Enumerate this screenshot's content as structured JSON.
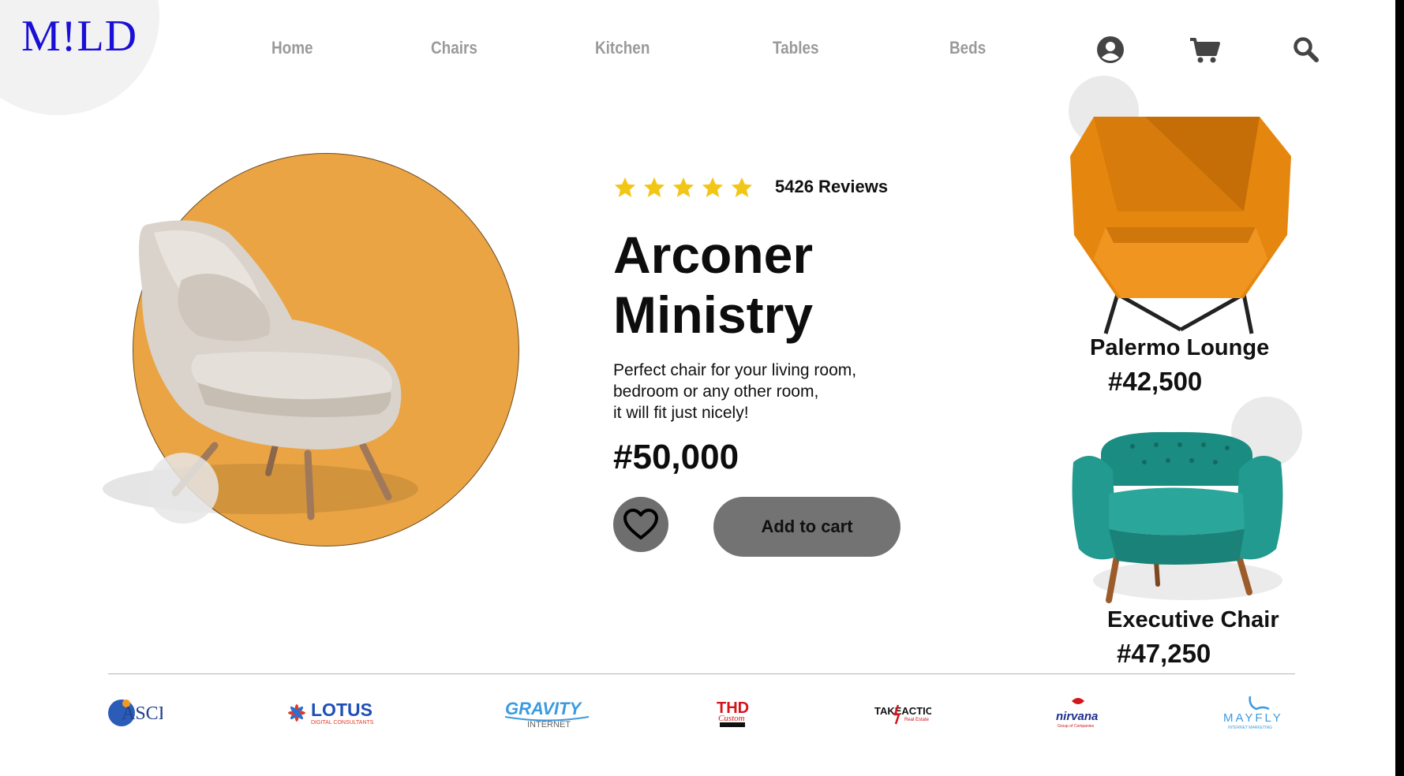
{
  "logo": "M!LD",
  "nav": {
    "items": [
      "Home",
      "Chairs",
      "Kitchen",
      "Tables",
      "Beds"
    ],
    "icons": [
      "user-icon",
      "cart-icon",
      "search-icon"
    ]
  },
  "hero": {
    "rating": 5,
    "reviews": "5426 Reviews",
    "title_line1": "Arconer",
    "title_line2": "Ministry",
    "desc_line1": "Perfect chair for your living room,",
    "desc_line2": "bedroom or any other room,",
    "desc_line3": "it will fit just nicely!",
    "price": "#50,000",
    "add_to_cart": "Add to cart"
  },
  "side_products": [
    {
      "name": "Palermo Lounge",
      "price": "#42,500"
    },
    {
      "name": "Executive Chair",
      "price": "#47,250"
    }
  ],
  "brands": [
    {
      "name": "ASCK",
      "text": "ASCK"
    },
    {
      "name": "LOTUS",
      "text": "LOTUS",
      "sub": "DIGITAL CONSULTANTS"
    },
    {
      "name": "GRAVITY",
      "text": "GRAVITY",
      "sub": "INTERNET"
    },
    {
      "name": "THD",
      "text": "THD",
      "sub": "Custom"
    },
    {
      "name": "TAKE ACTION",
      "text": "TAKEACTION",
      "sub": "Real Estate"
    },
    {
      "name": "nirvana",
      "text": "nirvana",
      "sub": "Group of Companies"
    },
    {
      "name": "MAYFLY",
      "text": "MAYFLY",
      "sub": "INTERNET MARKETING"
    }
  ],
  "colors": {
    "accent_orange": "#eaa444",
    "logo_blue": "#1a0fd6",
    "star": "#f2c617",
    "button_gray": "#737373"
  }
}
